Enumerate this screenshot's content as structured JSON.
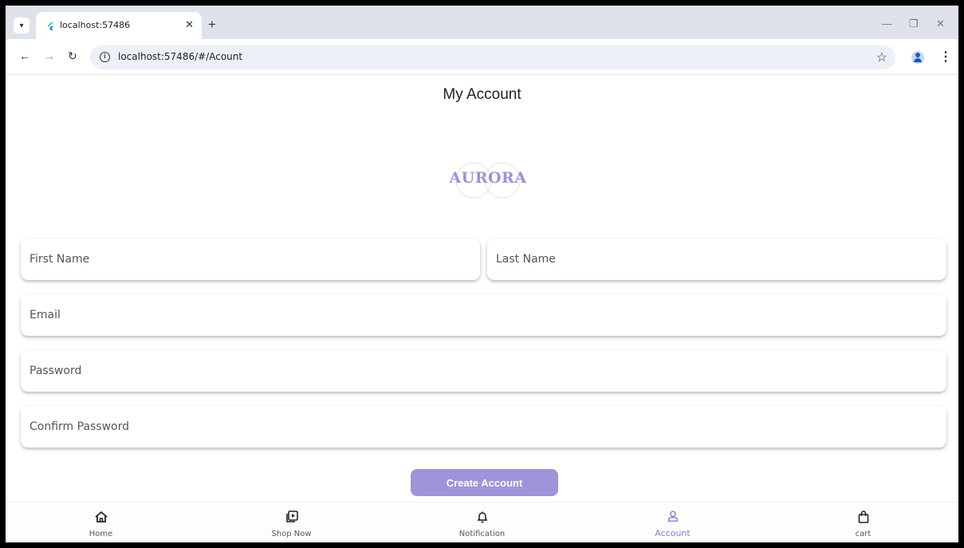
{
  "browser": {
    "tab_title": "localhost:57486",
    "url": "localhost:57486/#/Acount"
  },
  "page": {
    "title": "My Account",
    "logo_text": "AURORA"
  },
  "form": {
    "first_name_placeholder": "First Name",
    "last_name_placeholder": "Last Name",
    "email_placeholder": "Email",
    "password_placeholder": "Password",
    "confirm_password_placeholder": "Confirm Password",
    "submit_label": "Create Account"
  },
  "bottom_nav": {
    "items": [
      {
        "label": "Home",
        "icon": "home-icon"
      },
      {
        "label": "Shop Now",
        "icon": "shop-now-icon"
      },
      {
        "label": "Notification",
        "icon": "bell-icon"
      },
      {
        "label": "Account",
        "icon": "account-icon",
        "active": true
      },
      {
        "label": "cart",
        "icon": "shopping-bag-icon"
      }
    ]
  },
  "colors": {
    "accent": "#9f94d9",
    "logo": "#9d90d8",
    "active_nav": "#8a7bcf"
  }
}
